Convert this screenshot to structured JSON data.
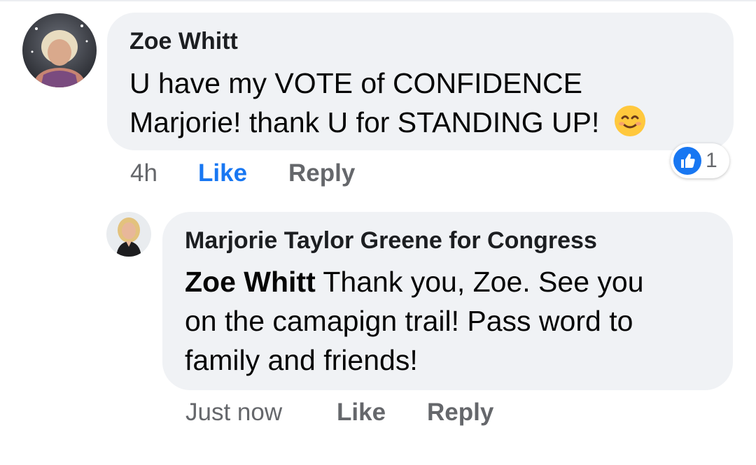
{
  "comment": {
    "author": "Zoe Whitt",
    "lines": [
      "U have my VOTE of CONFIDENCE",
      "Marjorie! thank U for STANDING UP!"
    ],
    "emoji": "smiling-face-emoji",
    "time": "4h",
    "like_label": "Like",
    "reply_label": "Reply",
    "reaction_count": "1",
    "like_color": "#1877f2"
  },
  "reply": {
    "author": "Marjorie Taylor Greene for Congress",
    "mention": "Zoe Whitt",
    "line1_rest": " Thank you, Zoe. See you",
    "line2": "on the camapign trail! Pass word to",
    "line3": "family and friends!",
    "time": "Just now",
    "like_label": "Like",
    "reply_label": "Reply"
  }
}
